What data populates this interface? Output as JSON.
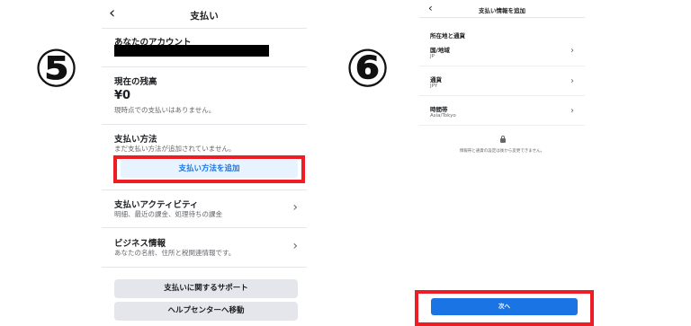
{
  "steps": {
    "left": "⑤",
    "right": "⑥"
  },
  "left_screen": {
    "title": "支払い",
    "back_icon": "chevron-left-icon",
    "account": {
      "label": "あなたのアカウント"
    },
    "balance": {
      "label": "現在の残高",
      "amount": "¥0",
      "note": "現時点での支払いはありません。"
    },
    "payment_method": {
      "label": "支払い方法",
      "note": "まだ支払い方法が追加されていません。",
      "add_button": "支払い方法を追加"
    },
    "activity": {
      "label": "支払いアクティビティ",
      "note": "明細、最近の課金、処理待ちの課金"
    },
    "business": {
      "label": "ビジネス情報",
      "note": "あなたの名前、住所と税関連情報です。"
    },
    "support_button": "支払いに関するサポート",
    "help_button": "ヘルプセンターへ移動"
  },
  "right_screen": {
    "title": "支払い情報を追加",
    "section_title": "所在地と通貨",
    "rows": [
      {
        "label": "国/地域",
        "value": "JP"
      },
      {
        "label": "通貨",
        "value": "JPY"
      },
      {
        "label": "時間帯",
        "value": "Asia/Tokyo"
      }
    ],
    "lock_note": "情報帯と通貨の設定は後から変更できません。",
    "next_button": "次へ"
  },
  "colors": {
    "accent": "#1b74e4",
    "highlight": "#ee1c25",
    "button_bg": "#e4e6eb"
  }
}
